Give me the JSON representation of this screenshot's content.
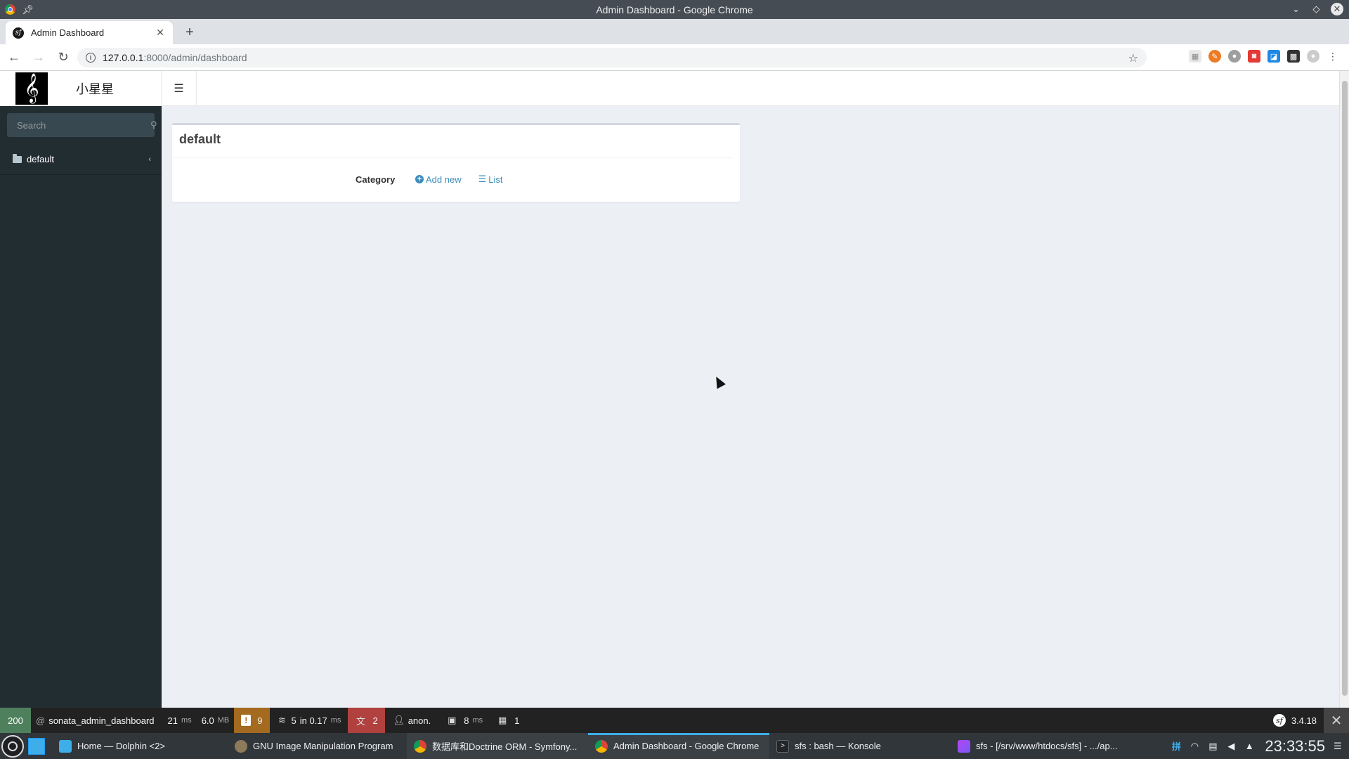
{
  "window": {
    "title": "Admin Dashboard - Google Chrome"
  },
  "browser": {
    "tab_title": "Admin Dashboard",
    "url_host": "127.0.0.1",
    "url_path": ":8000/admin/dashboard"
  },
  "app": {
    "logo_text": "小星星",
    "search_placeholder": "Search",
    "menu": [
      {
        "label": "default"
      }
    ]
  },
  "dashboard": {
    "box_title": "default",
    "rows": [
      {
        "label": "Category",
        "add_label": "Add new",
        "list_label": "List"
      }
    ]
  },
  "symfony_toolbar": {
    "status": "200",
    "route": "sonata_admin_dashboard",
    "time_value": "21",
    "time_unit": "ms",
    "memory_value": "6.0",
    "memory_unit": "MB",
    "warnings": "9",
    "queries_count": "5",
    "queries_time": "in 0.17",
    "queries_unit": "ms",
    "translation_errors": "2",
    "user": "anon.",
    "twig_time": "8",
    "twig_unit": "ms",
    "forms": "1",
    "sf_version": "3.4.18"
  },
  "taskbar": {
    "tasks": [
      {
        "label": "Home — Dolphin <2>"
      },
      {
        "label": "GNU Image Manipulation Program"
      },
      {
        "label": "数据库和Doctrine ORM - Symfony..."
      },
      {
        "label": "Admin Dashboard - Google Chrome"
      },
      {
        "label": "sfs : bash — Konsole"
      },
      {
        "label": "sfs - [/srv/www/htdocs/sfs] - .../ap..."
      }
    ],
    "clock": "23:33:55"
  },
  "colors": {
    "sidebar_bg": "#222d32",
    "link": "#3c8dbc",
    "content_bg": "#ecf0f5",
    "status_ok": "#4f805d",
    "warning": "#a46a1f",
    "error": "#b0413e"
  }
}
